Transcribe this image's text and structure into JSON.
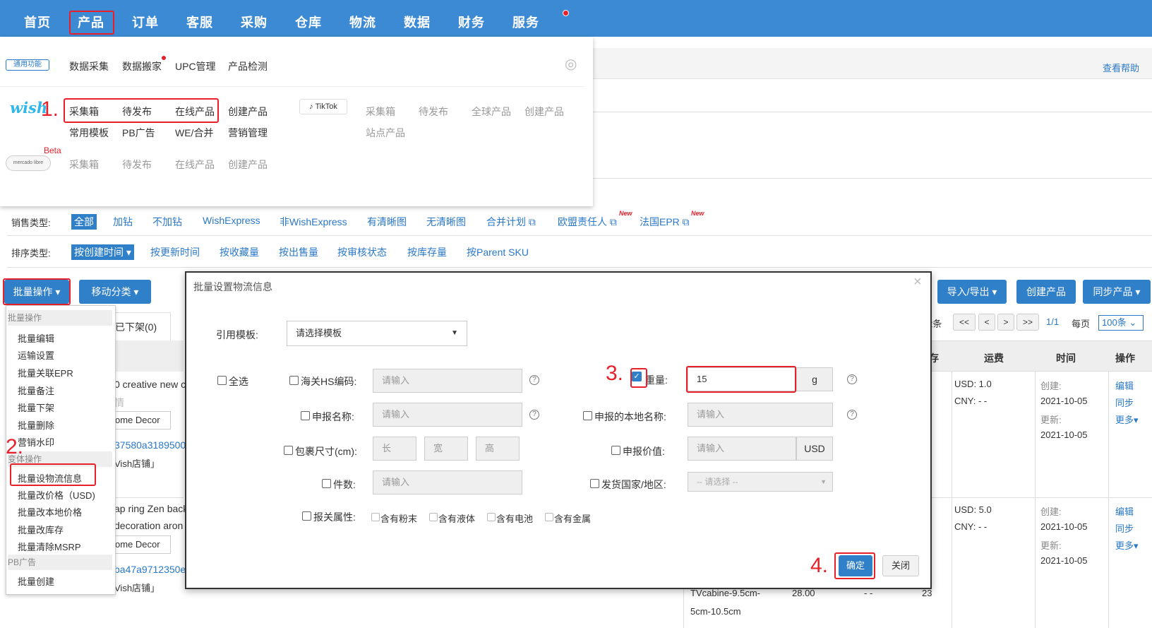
{
  "nav": {
    "items": [
      "首页",
      "产品",
      "订单",
      "客服",
      "采购",
      "仓库",
      "物流",
      "数据",
      "财务",
      "服务"
    ]
  },
  "general": {
    "badge": "通用功能",
    "items": [
      "数据采集",
      "数据搬家",
      "UPC管理",
      "产品检测"
    ]
  },
  "wish": {
    "logo": "wish",
    "row1": [
      "采集箱",
      "待发布",
      "在线产品",
      "创建产品"
    ],
    "row2": [
      "常用模板",
      "PB广告",
      "WE/合并",
      "营销管理"
    ]
  },
  "tiktok": {
    "logo": "TikTok",
    "row1": [
      "采集箱",
      "待发布",
      "全球产品",
      "创建产品"
    ],
    "row2": [
      "站点产品"
    ]
  },
  "mercado": {
    "logo": "mercado libre",
    "beta": "Beta",
    "items": [
      "采集箱",
      "待发布",
      "在线产品",
      "创建产品"
    ]
  },
  "help_link": "查看帮助",
  "filters": {
    "sales_label": "销售类型:",
    "sales_items": [
      "全部",
      "加钻",
      "不加钻",
      "WishExpress",
      "非WishExpress",
      "有清晰图",
      "无清晰图",
      "合并计划",
      "欧盟责任人",
      "法国EPR"
    ],
    "new_badge": "New",
    "sort_label": "排序类型:",
    "sort_items": [
      "按创建时间",
      "按更新时间",
      "按收藏量",
      "按出售量",
      "按审核状态",
      "按库存量",
      "按Parent SKU"
    ]
  },
  "toolbar": {
    "bulk_ops": "批量操作",
    "move_category": "移动分类",
    "import_export": "导入/导出",
    "create_product": "创建产品",
    "sync_product": "同步产品"
  },
  "bulk_menu": {
    "head1": "批量操作",
    "items1": [
      "批量编辑",
      "运输设置",
      "批量关联EPR",
      "批量备注",
      "批量下架",
      "批量删除",
      "营销水印"
    ],
    "head2": "变体操作",
    "items2": [
      "批量设物流信息",
      "批量改价格（USD)",
      "批量改本地价格",
      "批量改库存",
      "批量清除MSRP"
    ],
    "head3": "PB广告",
    "items3": [
      "批量创建"
    ]
  },
  "bg_tab": "已下架(0)",
  "pagination": {
    "count_suffix": "2条",
    "first": "<<",
    "prev": "<",
    "next": ">",
    "last": ">>",
    "page": "1/1",
    "per_page_label": "每页",
    "per_page_value": "100条"
  },
  "table": {
    "headers": [
      "存",
      "运费",
      "时间",
      "操作"
    ],
    "rows": [
      {
        "title_frag": "0 creative new c",
        "sub_frag": "情",
        "tag": "ome Decor",
        "sku_frag": "37580a3189500",
        "shop_frag": "Vish店铺」",
        "usd": "USD:  1.0",
        "cny": "CNY:  - -",
        "created_label": "创建:",
        "created": "2021-10-05",
        "updated_label": "更新:",
        "updated": "2021-10-05",
        "actions": [
          "编辑",
          "同步",
          "更多"
        ]
      },
      {
        "title_frag": "ap ring Zen back",
        "sub_frag": "decoration aron",
        "tag": "ome Decor",
        "sku_frag": "ba47a9712350e",
        "shop_frag": "Vish店铺」",
        "usd": "USD:  5.0",
        "cny": "CNY:  - -",
        "created_label": "创建:",
        "created": "2021-10-05",
        "updated_label": "更新:",
        "updated": "2021-10-05",
        "actions": [
          "编辑",
          "同步",
          "更多"
        ]
      }
    ],
    "bottom_variant": "TVcabine-9.5cm-",
    "bottom_variant2": "5cm-10.5cm",
    "bottom_price": "28.00",
    "bottom_dash": "- -",
    "bottom_stock": "23"
  },
  "modal": {
    "title": "批量设置物流信息",
    "close": "×",
    "template_label": "引用模板:",
    "template_value": "请选择模板",
    "select_all": "全选",
    "hs_label": "海关HS编码:",
    "hs_placeholder": "请输入",
    "weight_label": "重量:",
    "weight_value": "15",
    "weight_unit": "g",
    "decl_name_label": "申报名称:",
    "decl_name_placeholder": "请输入",
    "local_name_label": "申报的本地名称:",
    "local_name_placeholder": "请输入",
    "pkg_label": "包裹尺寸(cm):",
    "pkg_l": "长",
    "pkg_w": "宽",
    "pkg_h": "高",
    "decl_value_label": "申报价值:",
    "decl_value_placeholder": "请输入",
    "decl_value_unit": "USD",
    "pieces_label": "件数:",
    "pieces_placeholder": "请输入",
    "ship_country_label": "发货国家/地区:",
    "ship_country_placeholder": "-- 请选择 --",
    "customs_label": "报关属性:",
    "customs_items": [
      "含有粉末",
      "含有液体",
      "含有电池",
      "含有金属"
    ],
    "confirm": "确定",
    "cancel": "关闭"
  },
  "steps": [
    "1.",
    "2.",
    "3.",
    "4."
  ]
}
